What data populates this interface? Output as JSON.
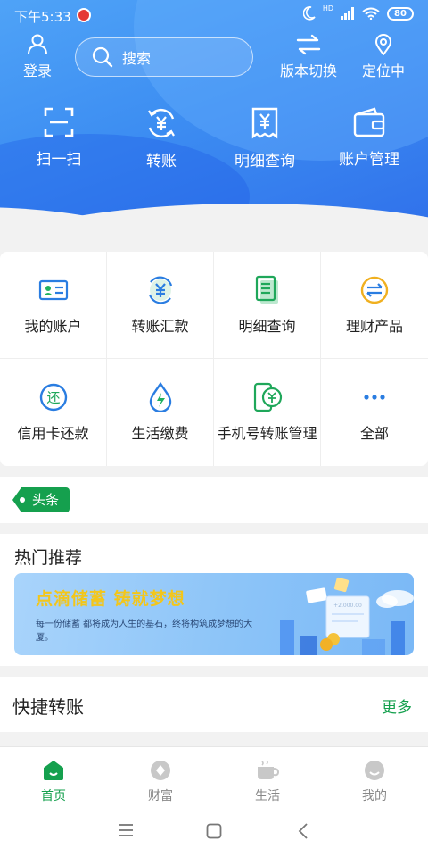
{
  "status_bar": {
    "time": "下午5:33",
    "battery": "80",
    "network": "HD"
  },
  "header": {
    "login_label": "登录",
    "search_placeholder": "搜索",
    "switch_label": "版本切换",
    "location_label": "定位中"
  },
  "quick_actions": [
    {
      "label": "扫一扫",
      "icon": "scan-icon"
    },
    {
      "label": "转账",
      "icon": "transfer-yen-icon"
    },
    {
      "label": "明细查询",
      "icon": "receipt-icon"
    },
    {
      "label": "账户管理",
      "icon": "wallet-icon"
    }
  ],
  "grid_items": [
    {
      "label": "我的账户",
      "icon": "id-card-icon"
    },
    {
      "label": "转账汇款",
      "icon": "transfer-yen-icon"
    },
    {
      "label": "明细查询",
      "icon": "document-list-icon"
    },
    {
      "label": "理财产品",
      "icon": "wealth-coin-icon"
    },
    {
      "label": "信用卡还款",
      "icon": "repay-icon"
    },
    {
      "label": "生活缴费",
      "icon": "water-drop-icon"
    },
    {
      "label": "手机号转账管理",
      "icon": "phone-transfer-icon"
    },
    {
      "label": "全部",
      "icon": "more-dots-icon"
    }
  ],
  "news": {
    "tag": "头条"
  },
  "hot": {
    "title": "热门推荐",
    "banner_title": "点滴储蓄 铸就梦想",
    "banner_subtitle": "每一份储蓄 都将成为人生的基石，终将构筑成梦想的大厦。",
    "banner_amount": "+2,000.00"
  },
  "transfer": {
    "title": "快捷转账",
    "more": "更多"
  },
  "bottom_nav": [
    {
      "label": "首页",
      "icon": "home-icon",
      "active": true
    },
    {
      "label": "财富",
      "icon": "wealth-icon",
      "active": false
    },
    {
      "label": "生活",
      "icon": "life-icon",
      "active": false
    },
    {
      "label": "我的",
      "icon": "profile-icon",
      "active": false
    }
  ],
  "colors": {
    "brand_green": "#15a04e",
    "header_blue": "#3d8ef2",
    "banner_gold": "#f3c61a"
  }
}
